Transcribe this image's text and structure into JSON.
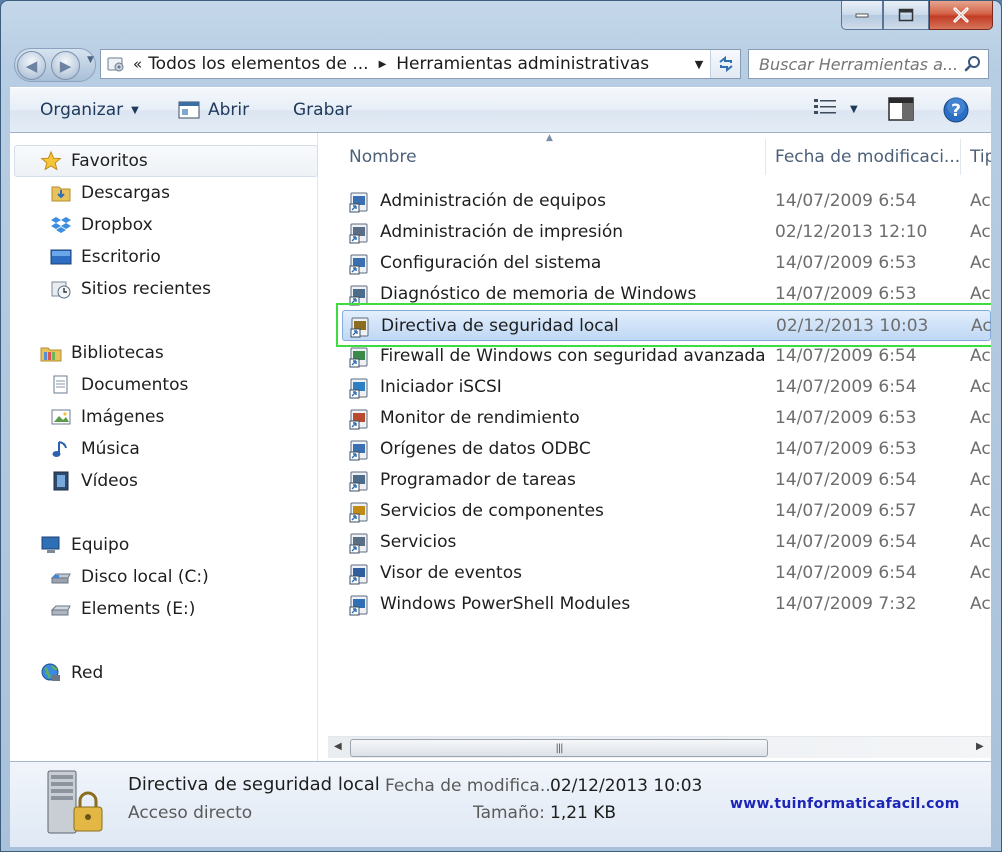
{
  "window": {
    "minimize_icon": "minimize-icon",
    "maximize_icon": "maximize-icon",
    "close_icon": "close-icon"
  },
  "address_bar": {
    "overflow": "«",
    "segments": [
      "Todos los elementos de ...",
      "Herramientas administrativas"
    ]
  },
  "search": {
    "placeholder": "Buscar Herramientas a..."
  },
  "toolbar": {
    "organize": "Organizar",
    "open": "Abrir",
    "burn": "Grabar"
  },
  "sidebar": {
    "favorites": {
      "label": "Favoritos",
      "items": [
        "Descargas",
        "Dropbox",
        "Escritorio",
        "Sitios recientes"
      ]
    },
    "libraries": {
      "label": "Bibliotecas",
      "items": [
        "Documentos",
        "Imágenes",
        "Música",
        "Vídeos"
      ]
    },
    "computer": {
      "label": "Equipo",
      "items": [
        "Disco local (C:)",
        "Elements (E:)"
      ]
    },
    "network": {
      "label": "Red"
    }
  },
  "columns": {
    "name": "Nombre",
    "modified": "Fecha de modificaci...",
    "type": "Tip"
  },
  "files": [
    {
      "name": "Administración de equipos",
      "date": "14/07/2009 6:54",
      "type": "Ac"
    },
    {
      "name": "Administración de impresión",
      "date": "02/12/2013 12:10",
      "type": "Ac"
    },
    {
      "name": "Configuración del sistema",
      "date": "14/07/2009 6:53",
      "type": "Ac"
    },
    {
      "name": "Diagnóstico de memoria de Windows",
      "date": "14/07/2009 6:53",
      "type": "Ac"
    },
    {
      "name": "Directiva de seguridad local",
      "date": "02/12/2013 10:03",
      "type": "Ac"
    },
    {
      "name": "Firewall de Windows con seguridad avanzada",
      "date": "14/07/2009 6:54",
      "type": "Ac"
    },
    {
      "name": "Iniciador iSCSI",
      "date": "14/07/2009 6:54",
      "type": "Ac"
    },
    {
      "name": "Monitor de rendimiento",
      "date": "14/07/2009 6:53",
      "type": "Ac"
    },
    {
      "name": "Orígenes de datos ODBC",
      "date": "14/07/2009 6:53",
      "type": "Ac"
    },
    {
      "name": "Programador de tareas",
      "date": "14/07/2009 6:54",
      "type": "Ac"
    },
    {
      "name": "Servicios de componentes",
      "date": "14/07/2009 6:57",
      "type": "Ac"
    },
    {
      "name": "Servicios",
      "date": "14/07/2009 6:54",
      "type": "Ac"
    },
    {
      "name": "Visor de eventos",
      "date": "14/07/2009 6:54",
      "type": "Ac"
    },
    {
      "name": "Windows PowerShell Modules",
      "date": "14/07/2009 7:32",
      "type": "Ac"
    }
  ],
  "selected_index": 4,
  "details": {
    "title": "Directiva de seguridad local",
    "subtitle": "Acceso directo",
    "modified_label": "Fecha de modifica...",
    "modified_value": "02/12/2013 10:03",
    "size_label": "Tamaño:",
    "size_value": "1,21 KB"
  },
  "watermark": "www.tuinformaticafacil.com",
  "colors": {
    "selection_bg": "#cfe2f8",
    "highlight_border": "#3fdc3f",
    "watermark": "#1c25b8"
  }
}
